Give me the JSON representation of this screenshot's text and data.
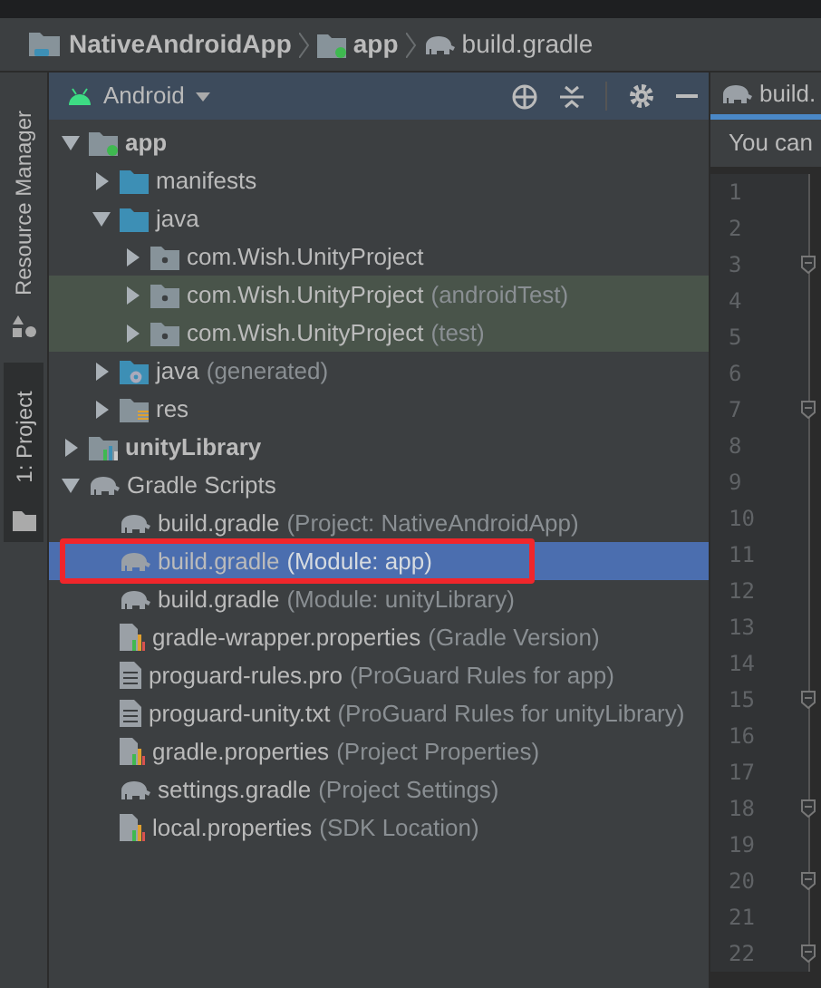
{
  "breadcrumb": [
    {
      "label": "NativeAndroidApp",
      "kind": "project"
    },
    {
      "label": "app",
      "kind": "module"
    },
    {
      "label": "build.gradle",
      "kind": "gradle"
    }
  ],
  "tool_strip": [
    {
      "label": "Resource Manager",
      "kind": "resources",
      "selected": false
    },
    {
      "label": "1: Project",
      "kind": "folder",
      "selected": true
    }
  ],
  "project_panel": {
    "view": "Android",
    "tree": [
      {
        "label": "app",
        "kind": "module",
        "expanded": true,
        "selected": false,
        "children": [
          {
            "label": "manifests",
            "kind": "folder",
            "expanded": false,
            "selected": false
          },
          {
            "label": "java",
            "kind": "folder",
            "expanded": true,
            "selected": false,
            "children": [
              {
                "label": "com.Wish.UnityProject",
                "kind": "package",
                "expanded": false,
                "selected": false
              },
              {
                "label": "com.Wish.UnityProject",
                "note": "(androidTest)",
                "kind": "package",
                "expanded": false,
                "selected": false,
                "highlighted": true
              },
              {
                "label": "com.Wish.UnityProject",
                "note": "(test)",
                "kind": "package",
                "expanded": false,
                "selected": false,
                "highlighted": true
              }
            ]
          },
          {
            "label": "java",
            "note": "(generated)",
            "kind": "generated",
            "expanded": false,
            "selected": false
          },
          {
            "label": "res",
            "kind": "res",
            "expanded": false,
            "selected": false
          }
        ]
      },
      {
        "label": "unityLibrary",
        "kind": "library",
        "expanded": false,
        "selected": false
      },
      {
        "label": "Gradle Scripts",
        "kind": "gradle-group",
        "expanded": true,
        "selected": false,
        "children": [
          {
            "label": "build.gradle",
            "note": "(Project: NativeAndroidApp)",
            "kind": "gradle",
            "selected": false
          },
          {
            "label": "build.gradle",
            "note": "(Module: app)",
            "kind": "gradle",
            "selected": true,
            "outlined": true
          },
          {
            "label": "build.gradle",
            "note": "(Module: unityLibrary)",
            "kind": "gradle",
            "selected": false
          },
          {
            "label": "gradle-wrapper.properties",
            "note": "(Gradle Version)",
            "kind": "properties",
            "selected": false
          },
          {
            "label": "proguard-rules.pro",
            "note": "(ProGuard Rules for app)",
            "kind": "text",
            "selected": false
          },
          {
            "label": "proguard-unity.txt",
            "note": "(ProGuard Rules for unityLibrary)",
            "kind": "text",
            "selected": false
          },
          {
            "label": "gradle.properties",
            "note": "(Project Properties)",
            "kind": "properties",
            "selected": false
          },
          {
            "label": "settings.gradle",
            "note": "(Project Settings)",
            "kind": "gradle",
            "selected": false
          },
          {
            "label": "local.properties",
            "note": "(SDK Location)",
            "kind": "properties",
            "selected": false
          }
        ]
      }
    ]
  },
  "editor": {
    "tab": "build.",
    "banner": "You can",
    "lines": [
      {
        "number": "1"
      },
      {
        "number": "2"
      },
      {
        "number": "3",
        "fold": true
      },
      {
        "number": "4"
      },
      {
        "number": "5"
      },
      {
        "number": "6"
      },
      {
        "number": "7",
        "fold": true
      },
      {
        "number": "8"
      },
      {
        "number": "9"
      },
      {
        "number": "10"
      },
      {
        "number": "11"
      },
      {
        "number": "12"
      },
      {
        "number": "13"
      },
      {
        "number": "14"
      },
      {
        "number": "15",
        "fold": true
      },
      {
        "number": "16"
      },
      {
        "number": "17"
      },
      {
        "number": "18",
        "fold": true
      },
      {
        "number": "19"
      },
      {
        "number": "20",
        "fold": true
      },
      {
        "number": "21"
      },
      {
        "number": "22",
        "fold": true
      }
    ]
  }
}
